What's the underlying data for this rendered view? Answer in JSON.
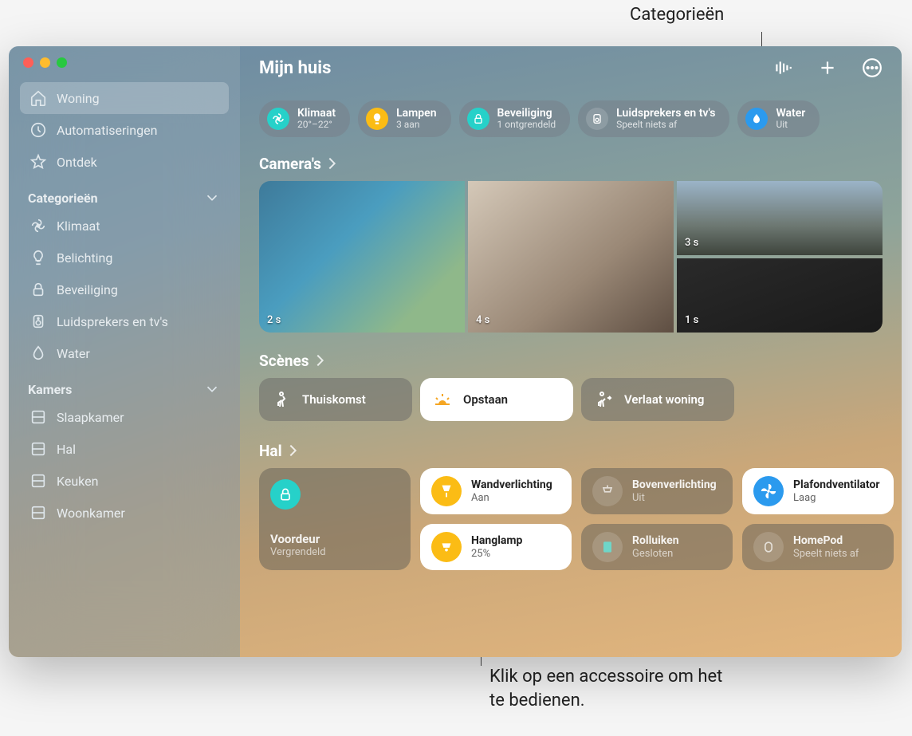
{
  "callouts": {
    "top": "Categorieën",
    "bottom": "Klik op een accessoire om het te bedienen."
  },
  "header": {
    "title": "Mijn huis"
  },
  "sidebar": {
    "nav": [
      {
        "label": "Woning",
        "active": true
      },
      {
        "label": "Automatiseringen",
        "active": false
      },
      {
        "label": "Ontdek",
        "active": false
      }
    ],
    "categories_header": "Categorieën",
    "categories": [
      {
        "label": "Klimaat"
      },
      {
        "label": "Belichting"
      },
      {
        "label": "Beveiliging"
      },
      {
        "label": "Luidsprekers en tv's"
      },
      {
        "label": "Water"
      }
    ],
    "rooms_header": "Kamers",
    "rooms": [
      {
        "label": "Slaapkamer"
      },
      {
        "label": "Hal"
      },
      {
        "label": "Keuken"
      },
      {
        "label": "Woonkamer"
      }
    ]
  },
  "category_pills": [
    {
      "title": "Klimaat",
      "sub": "20°–22°"
    },
    {
      "title": "Lampen",
      "sub": "3 aan"
    },
    {
      "title": "Beveiliging",
      "sub": "1 ontgrendeld"
    },
    {
      "title": "Luidsprekers en tv's",
      "sub": "Speelt niets af"
    },
    {
      "title": "Water",
      "sub": "Uit"
    }
  ],
  "sections": {
    "cameras": "Camera's",
    "scenes": "Scènes",
    "hal": "Hal"
  },
  "cameras": {
    "c1": "2 s",
    "c2": "3 s",
    "c3": "4 s",
    "c4": "1 s"
  },
  "scenes": [
    {
      "label": "Thuiskomst",
      "style": "dark"
    },
    {
      "label": "Opstaan",
      "style": "light"
    },
    {
      "label": "Verlaat woning",
      "style": "dark"
    }
  ],
  "tiles": {
    "voordeur": {
      "title": "Voordeur",
      "sub": "Vergrendeld"
    },
    "wand": {
      "title": "Wandverlichting",
      "sub": "Aan"
    },
    "boven": {
      "title": "Bovenverlichting",
      "sub": "Uit"
    },
    "plafond": {
      "title": "Plafondventilator",
      "sub": "Laag"
    },
    "hang": {
      "title": "Hanglamp",
      "sub": "25%"
    },
    "roll": {
      "title": "Rolluiken",
      "sub": "Gesloten"
    },
    "homepod": {
      "title": "HomePod",
      "sub": "Speelt niets af"
    }
  }
}
